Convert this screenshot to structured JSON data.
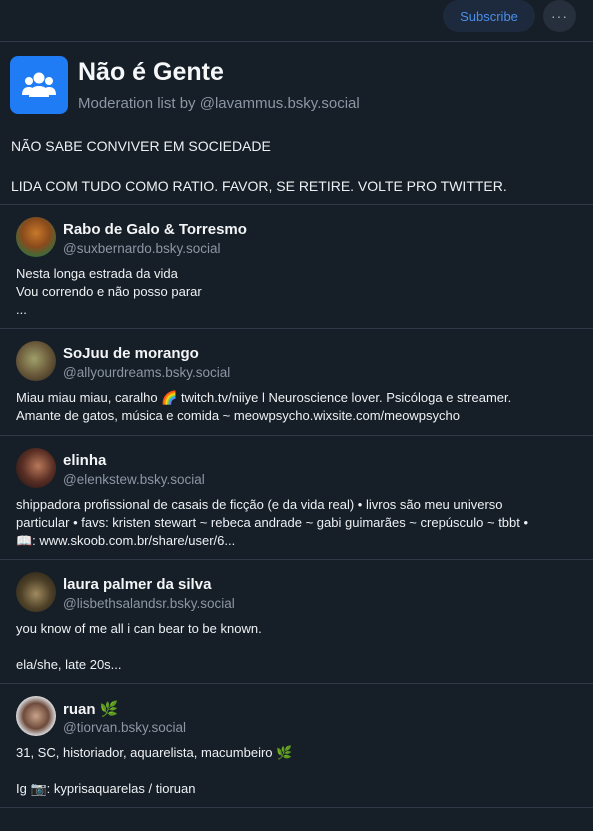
{
  "header": {
    "subscribe_label": "Subscribe",
    "more_label": "···"
  },
  "list": {
    "title": "Não é Gente",
    "subtitle": "Moderation list by @lavammus.bsky.social",
    "description_line1": "NÃO SABE CONVIVER EM SOCIEDADE",
    "description_line2": "LIDA COM TUDO COMO RATIO. FAVOR, SE RETIRE. VOLTE PRO TWITTER.",
    "accent_color": "#1f7cf4"
  },
  "members": [
    {
      "name": "Rabo de Galo & Torresmo",
      "handle": "@suxbernardo.bsky.social",
      "bio": "Nesta longa estrada da vida\nVou correndo e não posso parar\n..."
    },
    {
      "name": "SoJuu de morango",
      "handle": "@allyourdreams.bsky.social",
      "bio": "Miau miau miau, caralho 🌈 twitch.tv/niiye l Neuroscience lover. Psicóloga e streamer.\nAmante de gatos, música e comida ~ meowpsycho.wixsite.com/meowpsycho"
    },
    {
      "name": "elinha",
      "handle": "@elenkstew.bsky.social",
      "bio": "shippadora profissional de casais de ficção (e da vida real) • livros são meu universo\nparticular • favs: kristen stewart ~ rebeca andrade ~ gabi guimarães ~ crepúsculo ~ tbbt •\n📖: www.skoob.com.br/share/user/6..."
    },
    {
      "name": "laura palmer da silva",
      "handle": "@lisbethsalandsr.bsky.social",
      "bio": "you know of me all i can bear to be known.\n\nela/she, late 20s..."
    },
    {
      "name": "ruan 🌿",
      "handle": "@tiorvan.bsky.social",
      "bio": "31, SC, historiador, aquarelista, macumbeiro 🌿\n\nIg 📷: kyprisaquarelas / tioruan"
    }
  ]
}
